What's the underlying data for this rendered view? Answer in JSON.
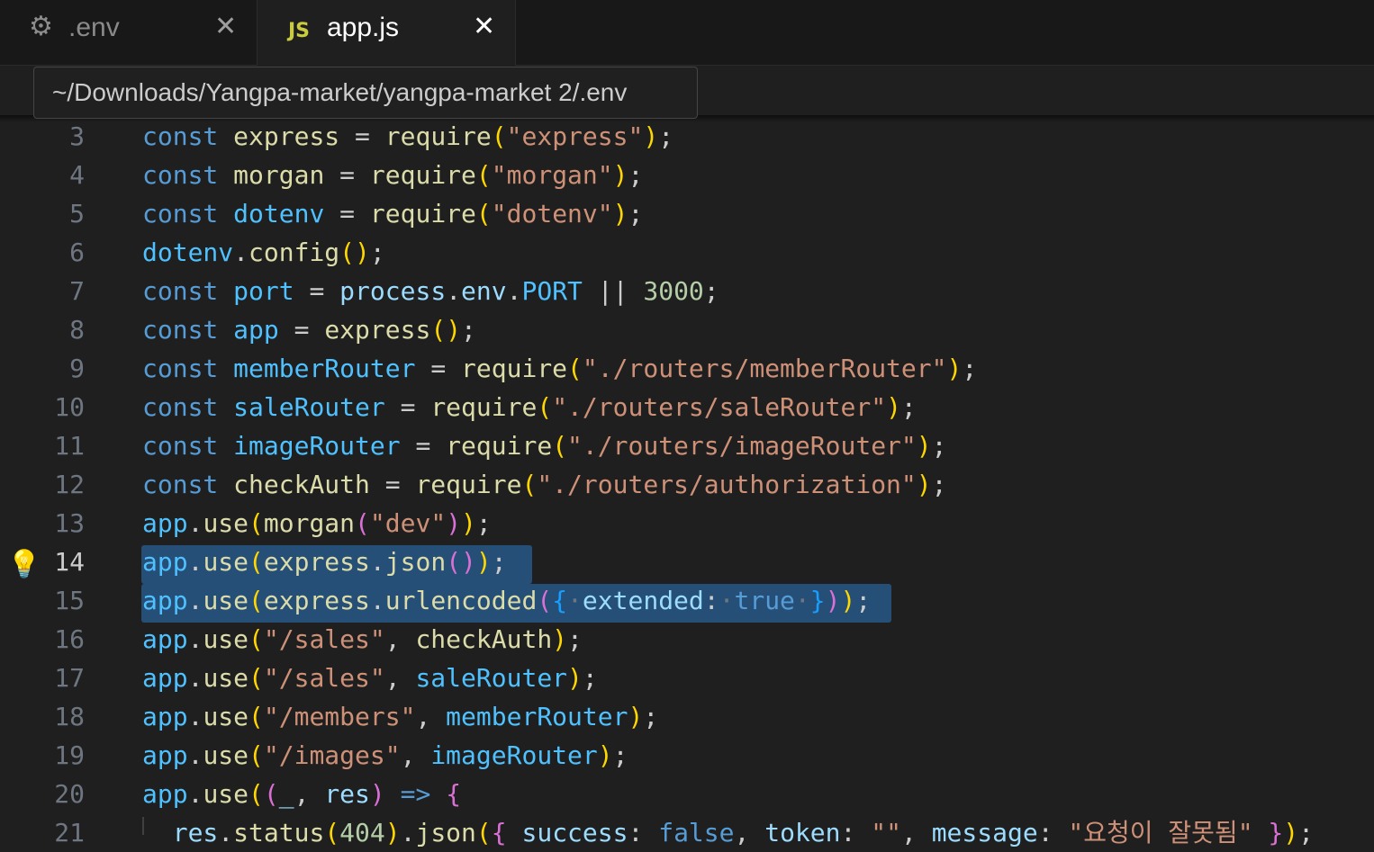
{
  "tabs": [
    {
      "label": ".env",
      "icon": "gear-icon",
      "active": false
    },
    {
      "label": "app.js",
      "icon": "js-file-icon",
      "icon_text": "JS",
      "active": true
    }
  ],
  "close_glyph": "✕",
  "tooltip": {
    "path": "~/Downloads/Yangpa-market/yangpa-market 2/.env"
  },
  "editor": {
    "active_line": 14,
    "lines": [
      {
        "no": "3",
        "text": "const express = require(\"express\");"
      },
      {
        "no": "4",
        "text": "const morgan = require(\"morgan\");"
      },
      {
        "no": "5",
        "text": "const dotenv = require(\"dotenv\");"
      },
      {
        "no": "6",
        "text": "dotenv.config();"
      },
      {
        "no": "7",
        "text": "const port = process.env.PORT || 3000;"
      },
      {
        "no": "8",
        "text": "const app = express();"
      },
      {
        "no": "9",
        "text": "const memberRouter = require(\"./routers/memberRouter\");"
      },
      {
        "no": "10",
        "text": "const saleRouter = require(\"./routers/saleRouter\");"
      },
      {
        "no": "11",
        "text": "const imageRouter = require(\"./routers/imageRouter\");"
      },
      {
        "no": "12",
        "text": "const checkAuth = require(\"./routers/authorization\");"
      },
      {
        "no": "13",
        "text": "app.use(morgan(\"dev\"));"
      },
      {
        "no": "14",
        "text": "app.use(express.json());"
      },
      {
        "no": "15",
        "text": "app.use(express.urlencoded({ extended: true }));"
      },
      {
        "no": "16",
        "text": "app.use(\"/sales\", checkAuth);"
      },
      {
        "no": "17",
        "text": "app.use(\"/sales\", saleRouter);"
      },
      {
        "no": "18",
        "text": "app.use(\"/members\", memberRouter);"
      },
      {
        "no": "19",
        "text": "app.use(\"/images\", imageRouter);"
      },
      {
        "no": "20",
        "text": "app.use((_, res) => {"
      },
      {
        "no": "21",
        "text": "  res.status(404).json({ success: false, token: \"\", message: \"요청이 잘못됨\" });"
      }
    ]
  },
  "colors": {
    "keyword": "#569cd6",
    "variable": "#4fc1ff",
    "function": "#dcdcaa",
    "string": "#ce9178",
    "number": "#b5cea8",
    "selection": "#264f78",
    "background": "#1f1f1f"
  }
}
